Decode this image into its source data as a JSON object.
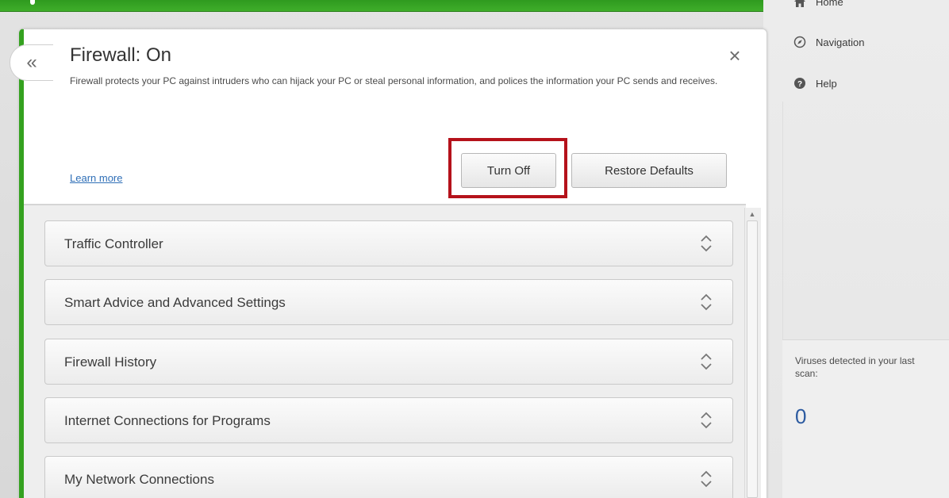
{
  "sidebar": {
    "items": [
      {
        "label": "Home",
        "icon": "home-icon"
      },
      {
        "label": "Navigation",
        "icon": "compass-icon"
      },
      {
        "label": "Help",
        "icon": "help-icon"
      }
    ],
    "viruses": {
      "label": "Viruses detected in your last scan:",
      "count": "0"
    }
  },
  "panel": {
    "title": "Firewall: On",
    "description": "Firewall protects your PC against intruders who can hijack your PC or steal personal information, and polices the information your PC sends and receives.",
    "learn_more": "Learn more",
    "turn_off_label": "Turn Off",
    "restore_label": "Restore Defaults"
  },
  "sections": [
    {
      "label": "Traffic Controller"
    },
    {
      "label": "Smart Advice and Advanced Settings"
    },
    {
      "label": "Firewall History"
    },
    {
      "label": "Internet Connections for Programs"
    },
    {
      "label": "My Network Connections"
    }
  ],
  "colors": {
    "accent_green": "#34a11f",
    "highlight_red": "#b5121b",
    "link_blue": "#2f6fb7"
  }
}
